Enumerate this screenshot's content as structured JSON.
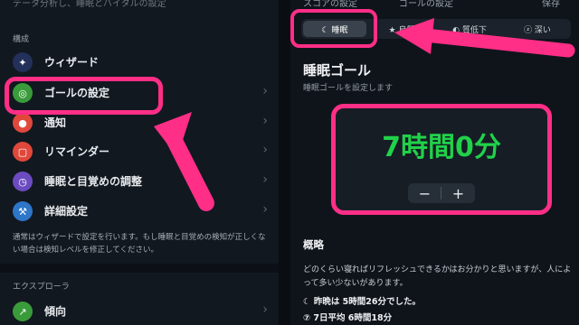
{
  "left": {
    "header_cut": "データ分析し、睡眠とバイタルの設定",
    "section_config": "構成",
    "items": [
      {
        "label": "ウィザード",
        "icon": "wizard-icon",
        "color": "#23305a",
        "glyph": "🧙"
      },
      {
        "label": "ゴールの設定",
        "icon": "target-icon",
        "color": "#3a9b3a",
        "glyph": "◎"
      },
      {
        "label": "通知",
        "icon": "bell-icon",
        "color": "#e0483b",
        "glyph": "🔔"
      },
      {
        "label": "リマインダー",
        "icon": "reminder-icon",
        "color": "#e0483b",
        "glyph": "▢"
      },
      {
        "label": "睡眠と目覚めの調整",
        "icon": "clock-icon",
        "color": "#6c4bc1",
        "glyph": "◷"
      },
      {
        "label": "詳細設定",
        "icon": "wrench-icon",
        "color": "#2d76c8",
        "glyph": "🔧"
      }
    ],
    "note": "通常はウィザードで設定を行います。もし睡眠と目覚めの検知が正しくない場合は検知レベルを修正してください。",
    "section_explorer": "エクスプローラ",
    "trend": {
      "label": "傾向",
      "icon": "trend-icon",
      "color": "#3a9b3a",
      "glyph": "↗"
    }
  },
  "right": {
    "topbar_left": "スコアの設定",
    "topbar_center": "ゴールの設定",
    "topbar_right": "保存",
    "tabs": [
      {
        "label": "☾ 睡眠"
      },
      {
        "label": "★ 良質"
      },
      {
        "label": "◐ 質低下"
      },
      {
        "label": "ⓩ 深い"
      }
    ],
    "goal_title": "睡眠ゴール",
    "goal_subtitle": "睡眠ゴールを設定します",
    "goal_value": "7時間0分",
    "minus": "−",
    "plus": "+",
    "overview_title": "概略",
    "overview_text": "どのくらい寝ればリフレッシュできるかはお分かりと思いますが、人によって多い少ないがあります。",
    "stat_last_night": "☾ 昨晩は 5時間26分でした。",
    "stat_week_avg": "⑦ 7日平均 6時間18分"
  },
  "colors": {
    "highlight": "#ff2e86",
    "goal_green": "#21d14a"
  }
}
